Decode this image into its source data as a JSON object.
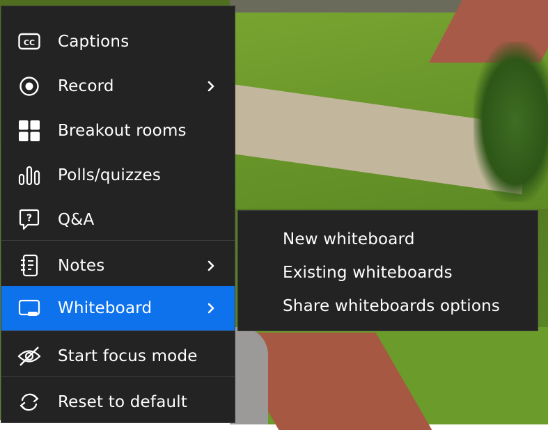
{
  "menu": {
    "items": [
      {
        "label": "Captions",
        "icon": "captions-icon"
      },
      {
        "label": "Record",
        "icon": "record-icon",
        "has_submenu": true
      },
      {
        "label": "Breakout rooms",
        "icon": "breakout-rooms-icon"
      },
      {
        "label": "Polls/quizzes",
        "icon": "polls-icon"
      },
      {
        "label": "Q&A",
        "icon": "qa-icon"
      },
      {
        "label": "Notes",
        "icon": "notes-icon",
        "has_submenu": true
      },
      {
        "label": "Whiteboard",
        "icon": "whiteboard-icon",
        "has_submenu": true,
        "active": true
      },
      {
        "label": "Start focus mode",
        "icon": "focus-mode-icon"
      },
      {
        "label": "Reset to default",
        "icon": "reset-icon"
      }
    ]
  },
  "submenu": {
    "items": [
      {
        "label": "New whiteboard"
      },
      {
        "label": "Existing whiteboards"
      },
      {
        "label": "Share whiteboards options"
      }
    ]
  },
  "colors": {
    "menu_bg": "#232323",
    "active_bg": "#0e72ed",
    "text": "#ffffff"
  }
}
